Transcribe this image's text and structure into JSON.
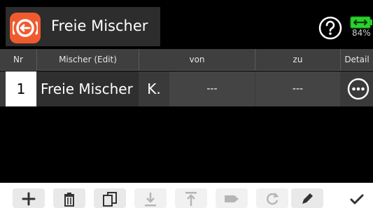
{
  "header": {
    "title": "Freie Mischer",
    "app_icon": "mixer-icon",
    "help_icon": "help-icon",
    "battery": {
      "icon": "battery-icon",
      "percent": "84%",
      "level": 0.84,
      "color": "#2bd12b"
    }
  },
  "table": {
    "columns": [
      "Nr",
      "Mischer (Edit)",
      "von",
      "zu",
      "Detail"
    ],
    "rows": [
      {
        "nr": "1",
        "mixer": "Freie Mischer",
        "k": "K.",
        "von": "---",
        "zu": "---",
        "detail_icon": "more-icon"
      }
    ]
  },
  "toolbar": {
    "buttons": [
      {
        "icon": "add-icon",
        "enabled": true
      },
      {
        "icon": "trash-icon",
        "enabled": true
      },
      {
        "icon": "copy-icon",
        "enabled": true
      },
      {
        "icon": "import-icon",
        "enabled": false
      },
      {
        "icon": "export-icon",
        "enabled": false
      },
      {
        "icon": "tag-icon",
        "enabled": false
      },
      {
        "icon": "refresh-icon",
        "enabled": false
      },
      {
        "icon": "edit-icon",
        "enabled": true
      },
      {
        "icon": "confirm-check-icon",
        "enabled": true
      }
    ]
  },
  "colors": {
    "accent": "#ef5b2f",
    "header_bg": "#2d2d2d",
    "table_header_bg": "#3f3f3f",
    "row_bg": "#444444",
    "selected_cell": "#ffffff"
  }
}
